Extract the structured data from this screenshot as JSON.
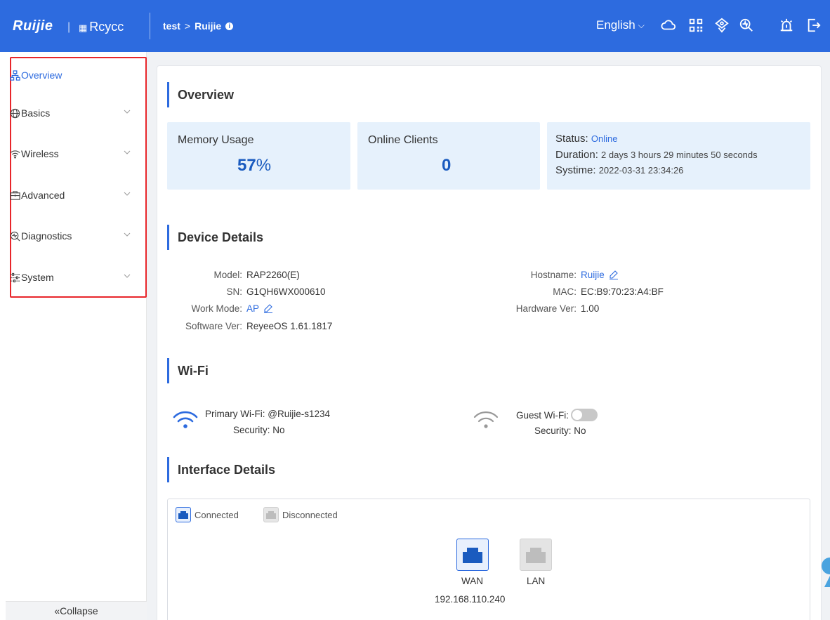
{
  "header": {
    "brand": "Ruijie",
    "brand_sep": "|",
    "sub_brand": "Rcycc",
    "breadcrumb_parent": "test",
    "breadcrumb_sep": ">",
    "breadcrumb_current": "Ruijie",
    "language": "English",
    "icons": [
      "cloud-icon",
      "qrcode-icon",
      "network-icon",
      "search-icon",
      "alert-icon",
      "logout-icon"
    ],
    "bg_color": "#2d6bdf"
  },
  "sidebar": {
    "items": [
      {
        "label": "Overview",
        "icon": "topology-icon",
        "active": true
      },
      {
        "label": "Basics",
        "icon": "globe-icon",
        "active": false
      },
      {
        "label": "Wireless",
        "icon": "wifi-icon",
        "active": false
      },
      {
        "label": "Advanced",
        "icon": "toolbox-icon",
        "active": false
      },
      {
        "label": "Diagnostics",
        "icon": "diagnostics-icon",
        "active": false
      },
      {
        "label": "System",
        "icon": "sliders-icon",
        "active": false
      }
    ],
    "collapse_label": "«Collapse"
  },
  "overview": {
    "title": "Overview",
    "memory": {
      "label": "Memory Usage",
      "value": "57",
      "unit": "%"
    },
    "clients": {
      "label": "Online Clients",
      "value": "0"
    },
    "status": {
      "status_label": "Status:",
      "status_value": "Online",
      "duration_label": "Duration:",
      "duration_value": "2 days 3 hours 29 minutes 50 seconds",
      "systime_label": "Systime:",
      "systime_value": "2022-03-31 23:34:26"
    }
  },
  "device": {
    "title": "Device Details",
    "model_label": "Model:",
    "model": "RAP2260(E)",
    "sn_label": "SN:",
    "sn": "G1QH6WX000610",
    "workmode_label": "Work Mode:",
    "workmode": "AP",
    "software_label": "Software Ver:",
    "software": "ReyeeOS 1.61.1817",
    "hostname_label": "Hostname:",
    "hostname": "Ruijie",
    "mac_label": "MAC:",
    "mac": "EC:B9:70:23:A4:BF",
    "hardware_label": "Hardware Ver:",
    "hardware": "1.00"
  },
  "wifi": {
    "title": "Wi-Fi",
    "primary_label": "Primary Wi-Fi:",
    "primary_ssid": "@Ruijie-s1234",
    "primary_security_label": "Security:",
    "primary_security": "No",
    "guest_label": "Guest Wi-Fi:",
    "guest_enabled": false,
    "guest_security_label": "Security:",
    "guest_security": "No"
  },
  "interfaces": {
    "title": "Interface Details",
    "legend_connected": "Connected",
    "legend_disconnected": "Disconnected",
    "ports": [
      {
        "label": "WAN",
        "connected": true,
        "ip": "192.168.110.240"
      },
      {
        "label": "LAN",
        "connected": false
      }
    ]
  },
  "colors": {
    "accent": "#2d6bdf",
    "stat_bg": "#e6f1fc",
    "highlight_box": "#e8262b",
    "value_blue": "#1a5bbf"
  }
}
